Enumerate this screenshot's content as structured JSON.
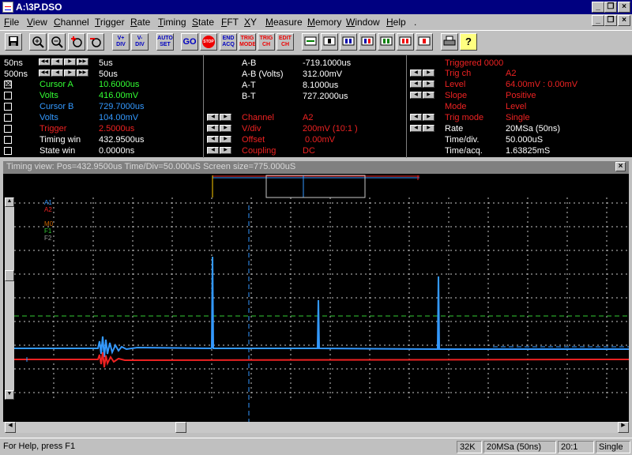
{
  "window": {
    "title": "A:\\3P.DSO"
  },
  "menu": [
    "File",
    "View",
    "Channel",
    "Trigger",
    "Rate",
    "Timing",
    "State",
    "FFT",
    "XY",
    "Measure",
    "Memory",
    "Window",
    "Help",
    "."
  ],
  "toolbar": {
    "buttons": [
      {
        "name": "save-icon",
        "label": ""
      },
      {
        "name": "zoom-in-icon",
        "label": "+"
      },
      {
        "name": "zoom-out-icon",
        "label": "−"
      },
      {
        "name": "zoom-plus-icon",
        "label": "+"
      },
      {
        "name": "zoom-minus-icon",
        "label": "−"
      },
      {
        "name": "volts-div-up",
        "label": "V+ DIV"
      },
      {
        "name": "volts-div-down",
        "label": "V- DIV"
      },
      {
        "name": "auto-set",
        "label": "AUTO SET"
      },
      {
        "name": "go",
        "label": "GO"
      },
      {
        "name": "stop",
        "label": "STOP"
      },
      {
        "name": "end-acq",
        "label": "END ACQ"
      },
      {
        "name": "trig-mode",
        "label": "TRIG MODE"
      },
      {
        "name": "trig-ch",
        "label": "TRIG CH"
      },
      {
        "name": "edit-ch",
        "label": "EDIT CH"
      }
    ]
  },
  "panel": {
    "left": [
      {
        "label": "50ns",
        "value": "5us"
      },
      {
        "label": "500ns",
        "value": "50us"
      }
    ],
    "cursors": [
      {
        "check": "☒",
        "label": "Cursor A",
        "value": "10.6000us",
        "cls": "g"
      },
      {
        "check": "",
        "label": "Volts",
        "value": "416.00mV",
        "cls": "g"
      },
      {
        "check": "",
        "label": "Cursor B",
        "value": "729.7000us",
        "cls": "c"
      },
      {
        "check": "",
        "label": "Volts",
        "value": "104.00mV",
        "cls": "c"
      },
      {
        "check": "",
        "label": "Trigger",
        "value": "2.5000us",
        "cls": "r"
      },
      {
        "check": "",
        "label": "Timing win",
        "value": "432.9500us",
        "cls": "w"
      },
      {
        "check": "",
        "label": "State win",
        "value": "0.0000ns",
        "cls": "w"
      }
    ],
    "middle": [
      {
        "label": "A-B",
        "value": "-719.1000us",
        "cls": "w"
      },
      {
        "label": "A-B (Volts)",
        "value": "312.00mV",
        "cls": "w"
      },
      {
        "label": "A-T",
        "value": "8.1000us",
        "cls": "w"
      },
      {
        "label": "B-T",
        "value": "727.2000us",
        "cls": "w"
      }
    ],
    "channel": [
      {
        "label": "Channel",
        "value": "A2"
      },
      {
        "label": "V/div",
        "value": "200mV (10:1  )"
      },
      {
        "label": "Offset",
        "value": " 0.00mV"
      },
      {
        "label": "Coupling",
        "value": "DC"
      }
    ],
    "trigger": {
      "header": "Triggered 0000",
      "rows": [
        {
          "label": "Trig ch",
          "value": "A2",
          "cls": "r"
        },
        {
          "label": "Level",
          "value": "64.00mV : 0.00mV",
          "cls": "r"
        },
        {
          "label": "Slope",
          "value": "Positive",
          "cls": "r"
        },
        {
          "label": "Mode",
          "value": "Level",
          "cls": "r"
        },
        {
          "label": "Trig mode",
          "value": "Single",
          "cls": "r"
        },
        {
          "label": "Rate",
          "value": "20MSa (50ns)",
          "cls": "w"
        },
        {
          "label": "Time/div.",
          "value": "50.000uS",
          "cls": "w"
        },
        {
          "label": "Time/acq.",
          "value": "1.63825mS",
          "cls": "w"
        }
      ]
    }
  },
  "timing_view": {
    "title": "Timing view: Pos=432.9500us Time/Div=50.000uS Screen size=775.000uS",
    "labels": [
      {
        "text": "A1",
        "color": "#3399ff"
      },
      {
        "text": "A2",
        "color": "#ee2222"
      },
      {
        "text": "M0",
        "color": "#cc6600"
      },
      {
        "text": "F1",
        "color": "#33cc33"
      },
      {
        "text": "F2",
        "color": "#999999"
      }
    ]
  },
  "status": {
    "help": "For Help, press F1",
    "cells": [
      "32K",
      "20MSa (50ns)",
      "20:1",
      "Single"
    ]
  },
  "colors": {
    "ch_a1": "#3399ff",
    "ch_a2": "#ee2222",
    "grid": "#c8c8c8",
    "cursor_a": "#33cc33",
    "cursor_b": "#3399ff"
  }
}
